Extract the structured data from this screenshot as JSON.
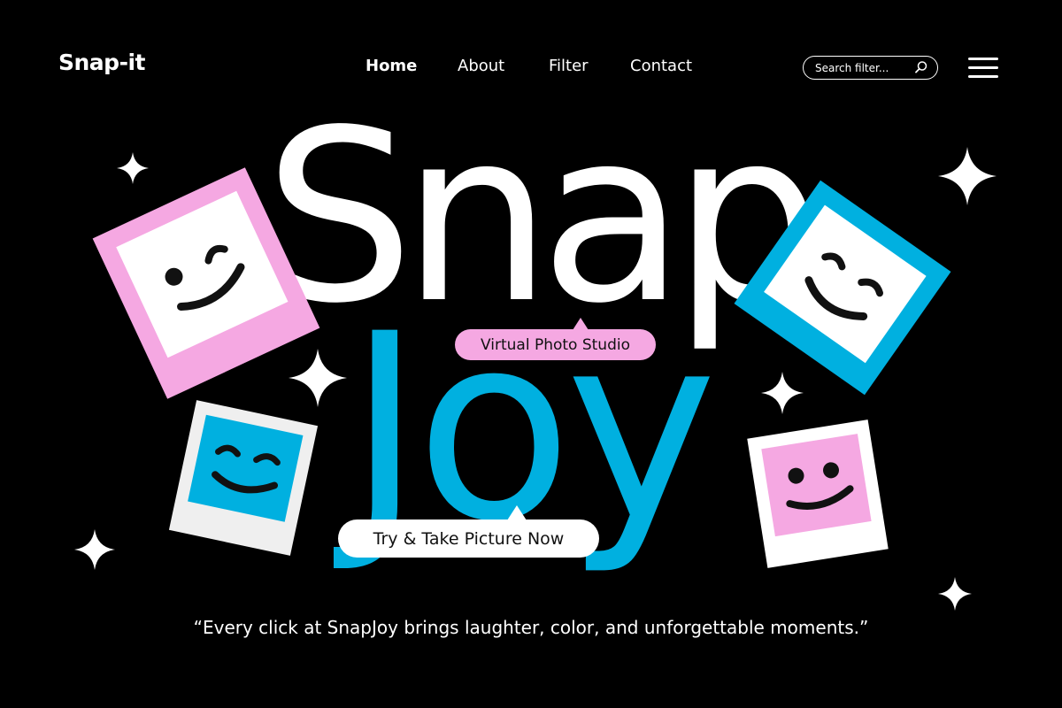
{
  "header": {
    "logo": "Snap-it",
    "nav": [
      "Home",
      "About",
      "Filter",
      "Contact"
    ],
    "active_nav": "Home",
    "search_placeholder": "Search filter..."
  },
  "hero": {
    "title_line1": "Snap",
    "title_line2": "Joy",
    "studio_label": "Virtual Photo Studio",
    "cta_label": "Try & Take Picture Now",
    "tagline": "“Every click at SnapJoy brings laughter, color, and unforgettable moments.”"
  },
  "colors": {
    "background": "#000000",
    "pink": "#f5a8e2",
    "blue": "#00b0e0",
    "white": "#ffffff"
  },
  "icons": [
    "search-icon",
    "hamburger-menu-icon",
    "sparkle-icon",
    "smiley-face-icon"
  ]
}
